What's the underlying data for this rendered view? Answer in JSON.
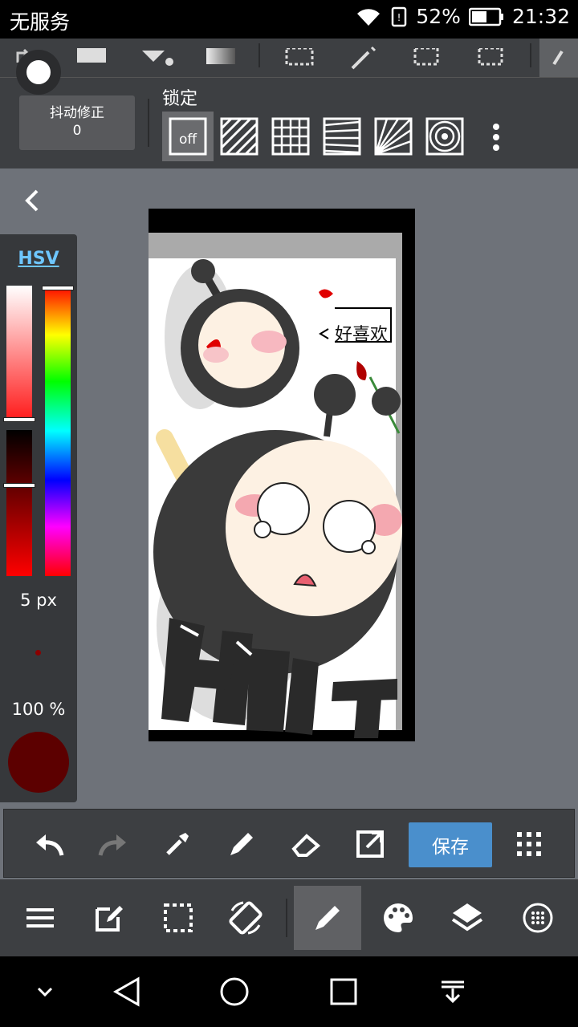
{
  "status_bar": {
    "carrier": "无服务",
    "battery": "52%",
    "time": "21:32"
  },
  "options": {
    "stabilizer_label": "抖动修正",
    "stabilizer_value": "0",
    "lock_title": "锁定",
    "lock_off": "off"
  },
  "color_panel": {
    "mode": "HSV",
    "brush_size": "5 px",
    "opacity": "100 %",
    "current_color": "#5c0000"
  },
  "artwork": {
    "text": "好喜欢"
  },
  "actions": {
    "save_label": "保存"
  },
  "colors": {
    "accent": "#4a8fcc",
    "panel": "#3d3f42",
    "canvas_bg": "#6e7279"
  }
}
